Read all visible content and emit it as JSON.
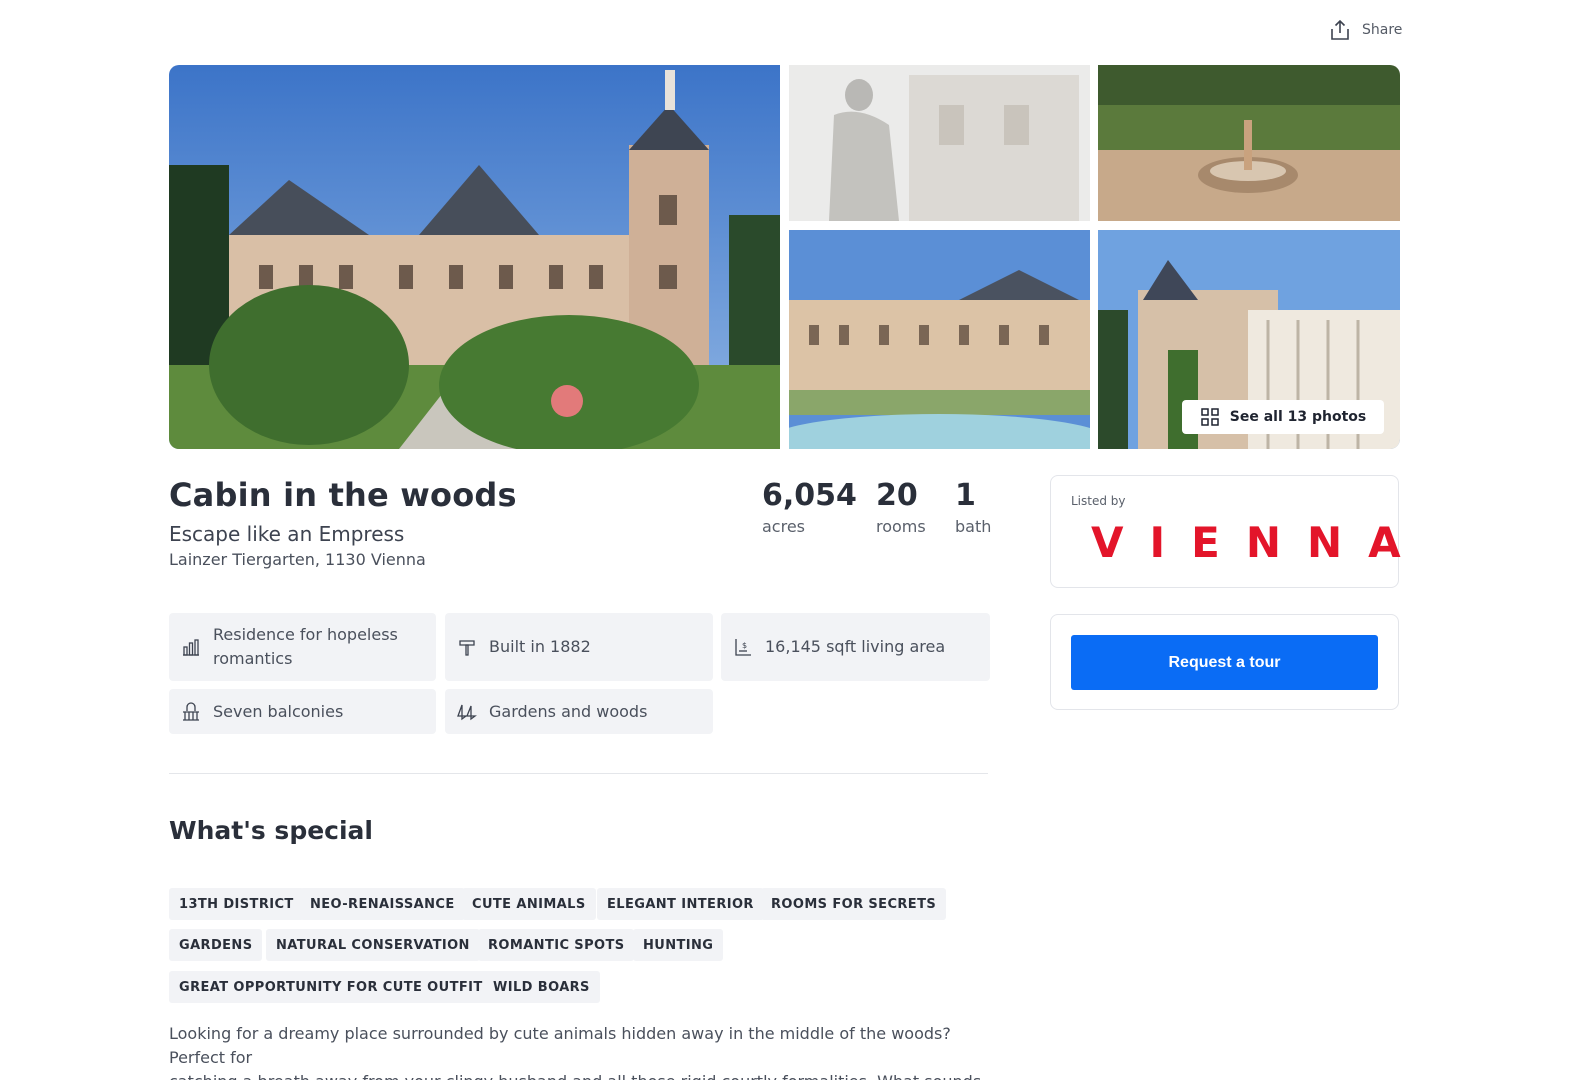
{
  "header": {
    "share_label": "Share"
  },
  "gallery": {
    "see_all_label": "See all 13 photos"
  },
  "listing": {
    "title": "Cabin in the woods",
    "subtitle": "Escape like an Empress",
    "address": "Lainzer Tiergarten, 1130 Vienna"
  },
  "stats": [
    {
      "value": "6,054",
      "label": "acres"
    },
    {
      "value": "20",
      "label": "rooms"
    },
    {
      "value": "1",
      "label": "bath"
    }
  ],
  "features": [
    {
      "icon": "building-chart-icon",
      "label": "Residence for hopeless romantics"
    },
    {
      "icon": "hammer-icon",
      "label": "Built in 1882"
    },
    {
      "icon": "area-price-icon",
      "label": "16,145 sqft living area"
    },
    {
      "icon": "balcony-icon",
      "label": "Seven balconies"
    },
    {
      "icon": "trees-icon",
      "label": "Gardens and woods"
    }
  ],
  "special": {
    "heading": "What's special",
    "tags": [
      "13TH DISTRICT",
      "NEO-RENAISSANCE",
      "CUTE ANIMALS",
      "ELEGANT INTERIOR",
      "ROOMS FOR SECRETS",
      "GARDENS",
      "NATURAL CONSERVATION",
      "ROMANTIC SPOTS",
      "HUNTING",
      "GREAT OPPORTUNITY FOR CUTE OUTFITS",
      "WILD BOARS"
    ],
    "description_line1": "Looking for a dreamy place surrounded by cute animals hidden away in the middle of the woods? Perfect for",
    "description_line2": "catching a breath away from your clingy husband and all those rigid courtly formalities. What sounds like a"
  },
  "listed_by": {
    "label": "Listed by",
    "brand": "VIENNA",
    "brand_color": "#e3152a"
  },
  "tour": {
    "button_label": "Request a tour",
    "button_color": "#0a6cf5"
  }
}
